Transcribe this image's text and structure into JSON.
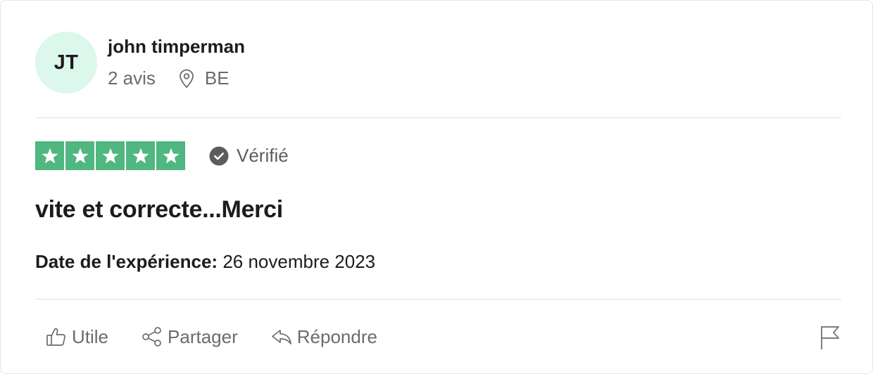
{
  "reviewer": {
    "initials": "JT",
    "name": "john timperman",
    "reviews_count": "2 avis",
    "country": "BE",
    "avatar_color": "#dcf7ec"
  },
  "rating": {
    "stars": 5,
    "star_color": "#4fb77f",
    "verified_label": "Vérifié"
  },
  "review": {
    "title": "vite et correcte...Merci",
    "experience_label": "Date de l'expérience:",
    "experience_date": "26 novembre 2023"
  },
  "actions": {
    "useful_label": "Utile",
    "share_label": "Partager",
    "reply_label": "Répondre",
    "icons": [
      "thumbs-up-icon",
      "share-icon",
      "reply-icon",
      "flag-icon"
    ]
  }
}
